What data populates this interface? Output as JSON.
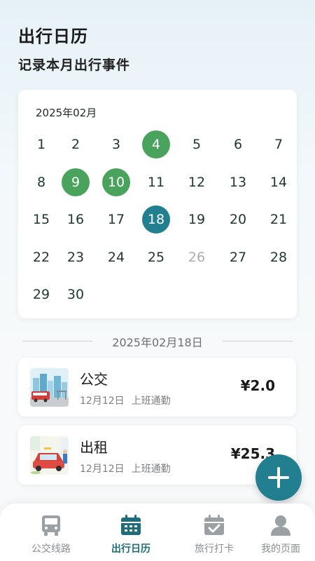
{
  "header": {
    "title": "出行日历",
    "subtitle": "记录本月出行事件"
  },
  "calendar": {
    "month_label": "2025年02月",
    "days": [
      {
        "label": "1",
        "state": "normal"
      },
      {
        "label": "2",
        "state": "normal"
      },
      {
        "label": "3",
        "state": "normal"
      },
      {
        "label": "4",
        "state": "has-trip"
      },
      {
        "label": "5",
        "state": "normal"
      },
      {
        "label": "6",
        "state": "normal"
      },
      {
        "label": "7",
        "state": "normal"
      },
      {
        "label": "8",
        "state": "normal"
      },
      {
        "label": "9",
        "state": "has-trip"
      },
      {
        "label": "10",
        "state": "has-trip"
      },
      {
        "label": "11",
        "state": "normal"
      },
      {
        "label": "12",
        "state": "normal"
      },
      {
        "label": "13",
        "state": "normal"
      },
      {
        "label": "14",
        "state": "normal"
      },
      {
        "label": "15",
        "state": "normal"
      },
      {
        "label": "16",
        "state": "normal"
      },
      {
        "label": "17",
        "state": "normal"
      },
      {
        "label": "18",
        "state": "selected"
      },
      {
        "label": "19",
        "state": "normal"
      },
      {
        "label": "20",
        "state": "normal"
      },
      {
        "label": "21",
        "state": "normal"
      },
      {
        "label": "22",
        "state": "normal"
      },
      {
        "label": "23",
        "state": "normal"
      },
      {
        "label": "24",
        "state": "normal"
      },
      {
        "label": "25",
        "state": "normal"
      },
      {
        "label": "26",
        "state": "disabled"
      },
      {
        "label": "27",
        "state": "normal"
      },
      {
        "label": "28",
        "state": "normal"
      },
      {
        "label": "29",
        "state": "normal"
      },
      {
        "label": "30",
        "state": "normal"
      }
    ]
  },
  "selected_date_label": "2025年02月18日",
  "records": [
    {
      "title": "公交",
      "date": "12月12日",
      "purpose": "上班通勤",
      "price": "¥2.0",
      "icon": "bus-stop-illustration"
    },
    {
      "title": "出租",
      "date": "12月12日",
      "purpose": "上班通勤",
      "price": "¥25.3",
      "icon": "taxi-illustration"
    }
  ],
  "fab": {
    "icon": "plus-icon"
  },
  "nav": {
    "items": [
      {
        "label": "公交线路",
        "icon": "bus-icon",
        "active": false
      },
      {
        "label": "出行日历",
        "icon": "calendar-icon",
        "active": true
      },
      {
        "label": "旅行打卡",
        "icon": "calendar-check-icon",
        "active": false
      },
      {
        "label": "我的页面",
        "icon": "user-icon",
        "active": false
      }
    ]
  },
  "colors": {
    "accent": "#227f8f",
    "trip_day": "#4aa35c",
    "disabled_day": "#a9aeb0"
  }
}
